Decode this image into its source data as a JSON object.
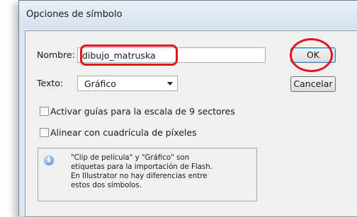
{
  "window": {
    "title": "Opciones de símbolo"
  },
  "form": {
    "name_label": "Nombre:",
    "name_value": "dibujo_matruska",
    "type_label": "Texto:",
    "type_value": "Gráfico"
  },
  "buttons": {
    "ok_label": "OK",
    "cancel_label": "Cancelar"
  },
  "options": {
    "guides_label": "Activar guías para la escala de 9 sectores",
    "guides_checked": false,
    "grid_label": "Alinear con cuadrícula de píxeles",
    "grid_checked": false
  },
  "info": {
    "icon": "info-icon",
    "lines": [
      "\"Clip de película\" y \"Gráfico\" son",
      "etiquetas para la importación de Flash.",
      "En Illustrator no hay diferencias entre",
      "estos dos símbolos."
    ]
  },
  "colors": {
    "highlight": "#e3151a",
    "client_background": "#f0f0f0",
    "frame": "#dde8f3"
  }
}
